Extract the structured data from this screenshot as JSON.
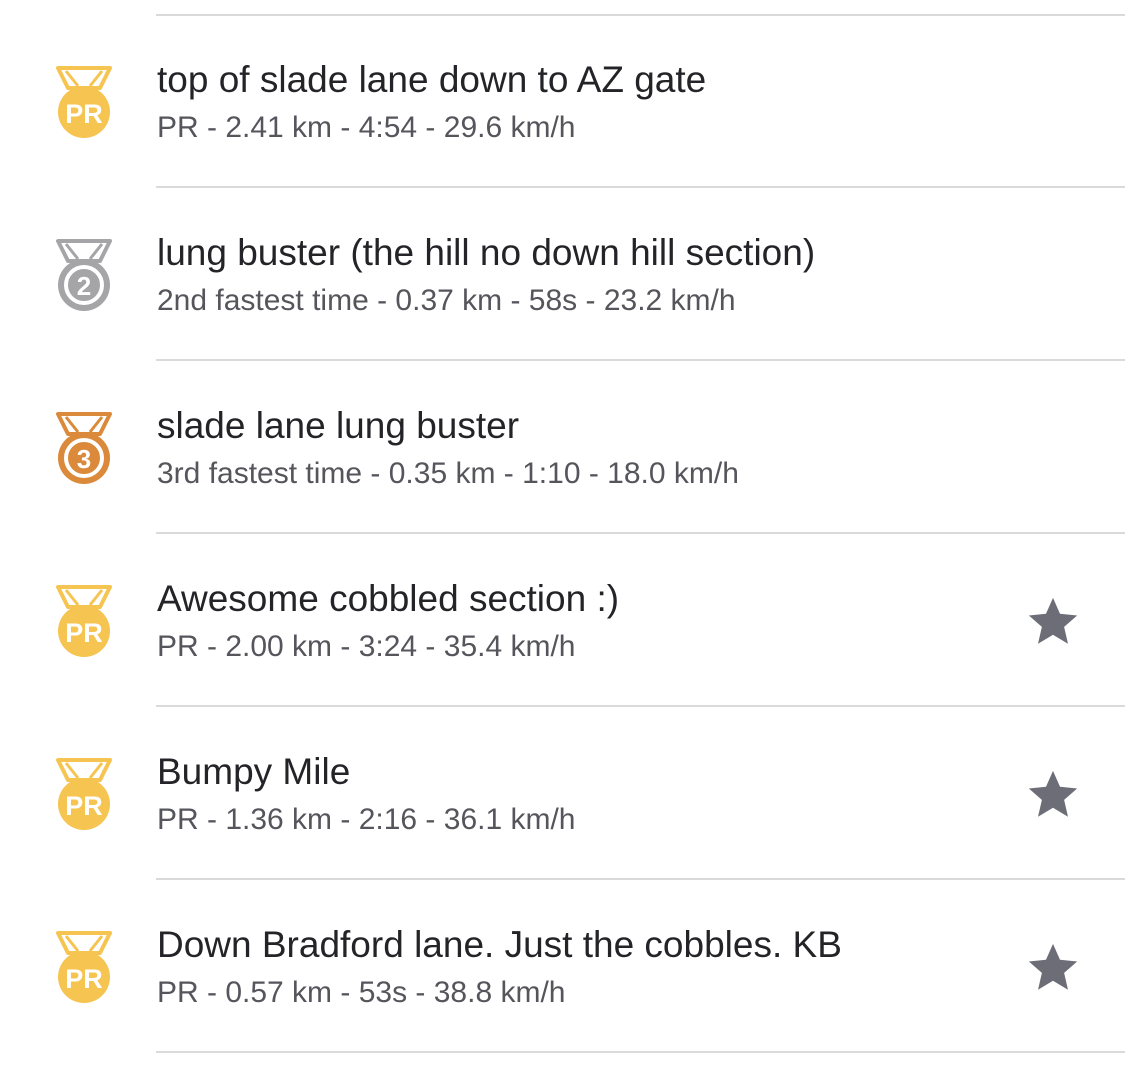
{
  "colors": {
    "gold": "#F5C451",
    "silver": "#A5A5A8",
    "bronze": "#DA8A3A",
    "star": "#6D6D78",
    "title_text": "#242428",
    "stats_text": "#55555c",
    "divider": "#dadada"
  },
  "segments": [
    {
      "title": "top of slade lane down to AZ gate",
      "stats": "PR - 2.41 km - 4:54 - 29.6 km/h",
      "medal": "gold-pr-medal-icon",
      "medal_label": "PR",
      "starred": false
    },
    {
      "title": "lung buster (the hill no down hill section)",
      "stats": "2nd fastest time - 0.37 km - 58s - 23.2 km/h",
      "medal": "silver-medal-icon",
      "medal_label": "2",
      "starred": false
    },
    {
      "title": "slade lane lung buster",
      "stats": "3rd fastest time - 0.35 km - 1:10 - 18.0 km/h",
      "medal": "bronze-medal-icon",
      "medal_label": "3",
      "starred": false
    },
    {
      "title": "Awesome cobbled section :)",
      "stats": "PR - 2.00 km - 3:24 - 35.4 km/h",
      "medal": "gold-pr-medal-icon",
      "medal_label": "PR",
      "starred": true
    },
    {
      "title": "Bumpy Mile",
      "stats": "PR - 1.36 km - 2:16 - 36.1 km/h",
      "medal": "gold-pr-medal-icon",
      "medal_label": "PR",
      "starred": true
    },
    {
      "title": "Down Bradford lane. Just the cobbles. KB",
      "stats": "PR - 0.57 km - 53s - 38.8 km/h",
      "medal": "gold-pr-medal-icon",
      "medal_label": "PR",
      "starred": true
    }
  ]
}
